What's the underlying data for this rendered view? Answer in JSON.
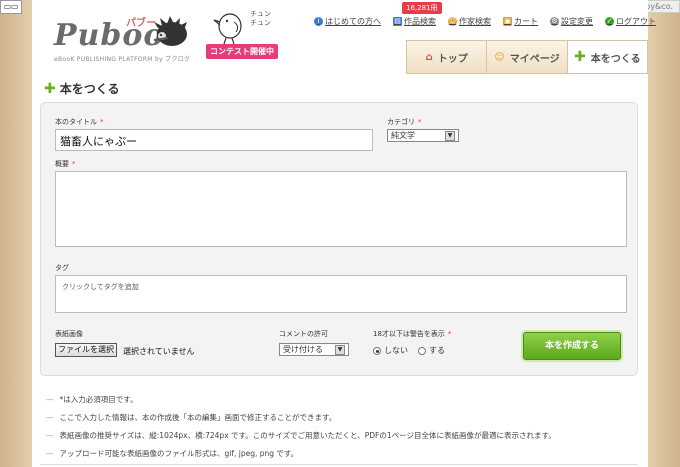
{
  "header": {
    "paperboy": "paperboy&co.",
    "logo_text": "Puboo",
    "logo_kana": "パブー",
    "logo_sub": "eBooK PUBLISHING PLATFORM by ブクログ",
    "bird_caption": "チュン\nチュン",
    "contest_badge": "コンテスト開催中",
    "count_badge": "16,281冊"
  },
  "topnav": [
    {
      "label": "はじめての方へ",
      "icon": "info-icon",
      "color": "#3a7bd5"
    },
    {
      "label": "作品検索",
      "icon": "book-search-icon",
      "color": "#3a7bd5"
    },
    {
      "label": "作家検索",
      "icon": "author-search-icon",
      "color": "#e0a020"
    },
    {
      "label": "カート",
      "icon": "cart-icon",
      "color": "#e0a020"
    },
    {
      "label": "設定変更",
      "icon": "gear-icon",
      "color": "#888888"
    },
    {
      "label": "ログアウト",
      "icon": "check-icon",
      "color": "#3aa020"
    }
  ],
  "tabs": [
    {
      "label": "トップ",
      "icon": "house-icon"
    },
    {
      "label": "マイページ",
      "icon": "smiley-icon"
    },
    {
      "label": "本をつくる",
      "icon": "plus-icon"
    }
  ],
  "page_title": "本をつくる",
  "form": {
    "title_label": "本のタイトル",
    "title_value": "猫畜人にゃぷー",
    "category_label": "カテゴリ",
    "category_value": "純文学",
    "summary_label": "概要",
    "tag_label": "タグ",
    "tag_placeholder": "クリックしてタグを追加",
    "cover_label": "表紙画像",
    "file_button": "ファイルを選択",
    "file_status": "選択されていません",
    "comment_label": "コメントの許可",
    "comment_value": "受け付ける",
    "warning_label": "18才以下は警告を表示",
    "radio_no": "しない",
    "radio_yes": "する",
    "required_mark": "*",
    "create_button": "本を作成する"
  },
  "notes": [
    "*は入力必須項目です。",
    "ここで入力した情報は、本の作成後「本の編集」画面で修正することができます。",
    "表紙画像の推奨サイズは、縦:1024px、横:724px です。このサイズでご用意いただくと、PDFの1ページ目全体に表紙画像が最適に表示されます。",
    "アップロード可能な表紙画像のファイル形式は、gif, jpeg, png です。"
  ]
}
